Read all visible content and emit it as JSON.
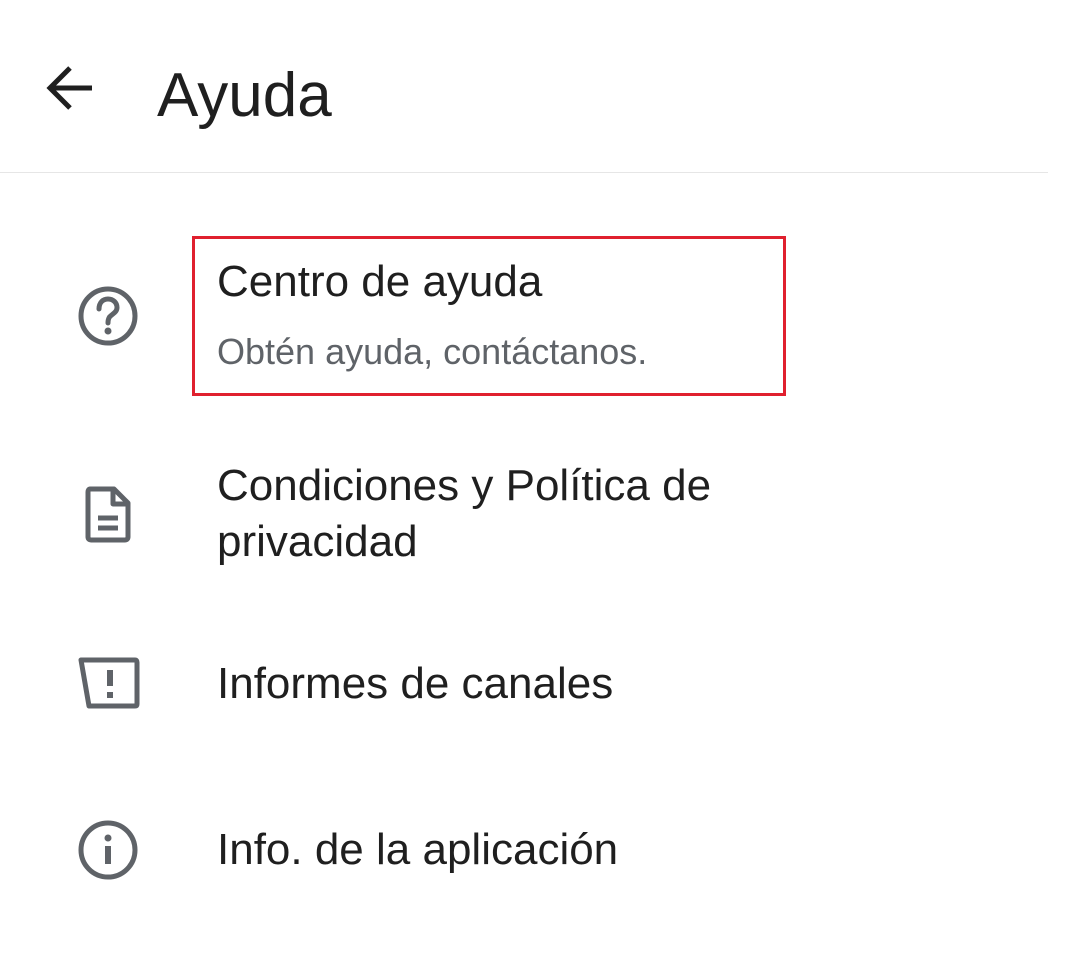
{
  "header": {
    "title": "Ayuda",
    "back_icon": "arrow-back-icon"
  },
  "menu": {
    "items": [
      {
        "id": "help-center",
        "label": "Centro de ayuda",
        "subtitle": "Obtén ayuda, contáctanos.",
        "icon": "help-circle-icon",
        "highlighted": true
      },
      {
        "id": "terms-privacy",
        "label_line1": "Condiciones y Política de",
        "label_line2": "privacidad",
        "icon": "document-icon"
      },
      {
        "id": "channel-reports",
        "label": "Informes de canales",
        "icon": "report-icon"
      },
      {
        "id": "app-info",
        "label": "Info. de la aplicación",
        "icon": "info-icon"
      }
    ]
  },
  "colors": {
    "icon": "#5f6368",
    "text_primary": "#1f1f1f",
    "text_secondary": "#5f6368",
    "highlight_border": "#e0202e"
  }
}
